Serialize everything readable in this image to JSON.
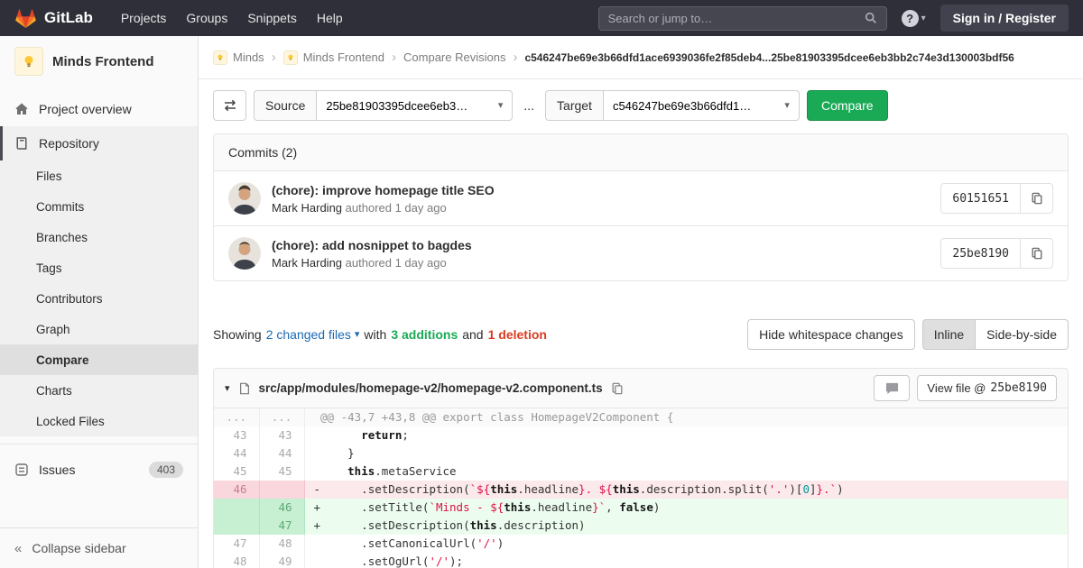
{
  "navbar": {
    "brand": "GitLab",
    "links": [
      "Projects",
      "Groups",
      "Snippets",
      "Help"
    ],
    "search_placeholder": "Search or jump to…",
    "help_glyph": "?",
    "sign_in_label": "Sign in / Register"
  },
  "glyphs": {
    "caret_down": "▾",
    "breadcrumb_separator": "›",
    "collapse": "«"
  },
  "sidebar": {
    "project_name": "Minds Frontend",
    "overview_label": "Project overview",
    "repository_label": "Repository",
    "repo_children": [
      "Files",
      "Commits",
      "Branches",
      "Tags",
      "Contributors",
      "Graph",
      "Compare",
      "Charts",
      "Locked Files"
    ],
    "issues_label": "Issues",
    "issues_badge": "403",
    "collapse_label": "Collapse sidebar"
  },
  "breadcrumb": {
    "group": "Minds",
    "project": "Minds Frontend",
    "page": "Compare Revisions",
    "current": "c546247be69e3b66dfd1ace6939036fe2f85deb4...25be81903395dcee6eb3bb2c74e3d130003bdf56"
  },
  "compare_form": {
    "source_label": "Source",
    "source_value": "25be81903395dcee6eb3…",
    "separator": "...",
    "target_label": "Target",
    "target_value": "c546247be69e3b66dfd1…",
    "compare_button": "Compare"
  },
  "commits": {
    "header": "Commits (2)",
    "items": [
      {
        "title": "(chore): improve homepage title SEO",
        "author": "Mark Harding",
        "meta": "authored 1 day ago",
        "sha": "60151651"
      },
      {
        "title": "(chore): add nosnippet to bagdes",
        "author": "Mark Harding",
        "meta": "authored 1 day ago",
        "sha": "25be8190"
      }
    ]
  },
  "diff_summary": {
    "showing": "Showing",
    "files_link": "2 changed files",
    "with_text": "with",
    "additions": "3 additions",
    "and_text": "and",
    "deletions": "1 deletion",
    "hide_whitespace": "Hide whitespace changes",
    "inline": "Inline",
    "side_by_side": "Side-by-side"
  },
  "diff_file": {
    "path": "src/app/modules/homepage-v2/homepage-v2.component.ts",
    "view_file_label": "View file @",
    "view_file_sha": "25be8190",
    "lines": [
      {
        "type": "hunk",
        "old": "...",
        "new": "...",
        "segments": [
          [
            "@@ -43,7 +43,8 @@ export class HomepageV2Component {",
            ""
          ]
        ]
      },
      {
        "type": "context",
        "old": "43",
        "new": "43",
        "segments": [
          [
            "      ",
            ""
          ],
          [
            "return",
            "k"
          ],
          [
            ";",
            ""
          ]
        ]
      },
      {
        "type": "context",
        "old": "44",
        "new": "44",
        "segments": [
          [
            "    }",
            ""
          ]
        ]
      },
      {
        "type": "context",
        "old": "45",
        "new": "45",
        "segments": [
          [
            "    ",
            ""
          ],
          [
            "this",
            "k"
          ],
          [
            ".metaService",
            ""
          ]
        ]
      },
      {
        "type": "del",
        "old": "46",
        "new": "",
        "segments": [
          [
            "      .setDescription(",
            ""
          ],
          [
            "`${",
            "s"
          ],
          [
            "this",
            "k"
          ],
          [
            ".headline",
            ""
          ],
          [
            "}",
            "s"
          ],
          [
            ". ",
            "s"
          ],
          [
            "${",
            "s"
          ],
          [
            "this",
            "k"
          ],
          [
            ".description.split(",
            ""
          ],
          [
            "'.'",
            "s"
          ],
          [
            ")[",
            ""
          ],
          [
            "0",
            "mi"
          ],
          [
            "]",
            ""
          ],
          [
            "}.`",
            "s"
          ],
          [
            ")",
            ""
          ]
        ]
      },
      {
        "type": "add",
        "old": "",
        "new": "46",
        "segments": [
          [
            "      .setTitle(",
            ""
          ],
          [
            "`Minds - ",
            "s"
          ],
          [
            "${",
            "s"
          ],
          [
            "this",
            "k"
          ],
          [
            ".headline",
            ""
          ],
          [
            "}`",
            "s"
          ],
          [
            ", ",
            ""
          ],
          [
            "false",
            "k"
          ],
          [
            ")",
            ""
          ]
        ]
      },
      {
        "type": "add",
        "old": "",
        "new": "47",
        "segments": [
          [
            "      .setDescription(",
            ""
          ],
          [
            "this",
            "k"
          ],
          [
            ".description)",
            ""
          ]
        ]
      },
      {
        "type": "context",
        "old": "47",
        "new": "48",
        "segments": [
          [
            "      .setCanonicalUrl(",
            ""
          ],
          [
            "'/'",
            "s"
          ],
          [
            ")",
            ""
          ]
        ]
      },
      {
        "type": "context",
        "old": "48",
        "new": "49",
        "segments": [
          [
            "      .setOgUrl(",
            ""
          ],
          [
            "'/'",
            "s"
          ],
          [
            ");",
            ""
          ]
        ]
      }
    ]
  }
}
